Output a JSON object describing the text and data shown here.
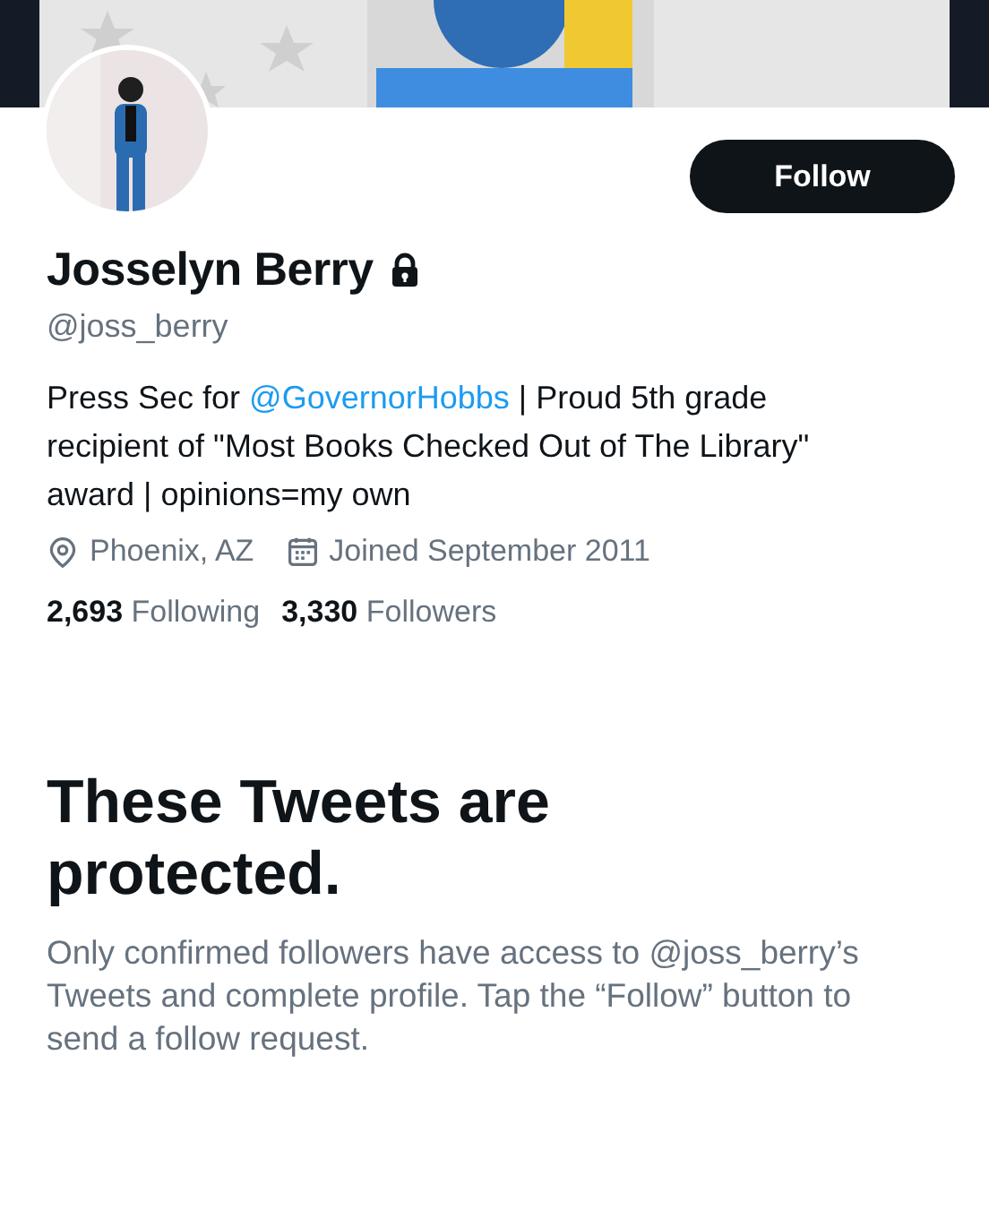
{
  "follow_button": "Follow",
  "profile": {
    "name": "Josselyn Berry",
    "protected": true,
    "handle": "@joss_berry",
    "bio": [
      {
        "kind": "text",
        "text": "Press Sec for "
      },
      {
        "kind": "link",
        "text": "@GovernorHobbs"
      },
      {
        "kind": "text",
        "text": " | Proud 5th grade recipient of \"Most Books Checked Out of The Library\" award | opinions=my own"
      }
    ],
    "location": "Phoenix, AZ",
    "joined": "Joined September 2011",
    "stats": [
      {
        "count": "2,693",
        "label": "Following"
      },
      {
        "count": "3,330",
        "label": "Followers"
      }
    ]
  },
  "protected_notice": {
    "title": "These Tweets are protected.",
    "body": "Only confirmed followers have access to @joss_berry’s Tweets and complete profile. Tap the “Follow” button to send a follow request."
  }
}
